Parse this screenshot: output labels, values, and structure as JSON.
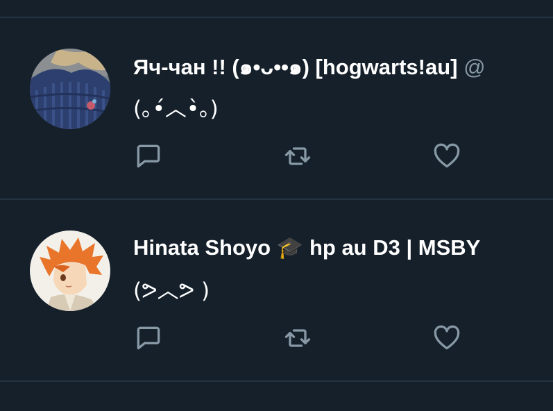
{
  "tweets": [
    {
      "display_name": "Яч-чан !! (๑•ᴗ••๑) [hogwarts!au]",
      "handle": "@",
      "name_emoji": "",
      "name_suffix": "",
      "text": "(｡•́︿•̀｡)",
      "avatar_icon": "sweater-photo-avatar",
      "actions": {
        "reply": "reply-icon",
        "retweet": "retweet-icon",
        "like": "heart-icon"
      }
    },
    {
      "display_name": "Hinata Shoyo",
      "handle": "",
      "name_emoji": "🎓",
      "name_suffix": "hp au D3 | MSBY",
      "text": "(ᕗ︿ᕗ )",
      "avatar_icon": "orange-hair-character-avatar",
      "actions": {
        "reply": "reply-icon",
        "retweet": "retweet-icon",
        "like": "heart-icon"
      }
    }
  ],
  "colors": {
    "background": "#15202b",
    "divider": "#253341",
    "icon": "#8899a6",
    "text": "#ffffff"
  }
}
